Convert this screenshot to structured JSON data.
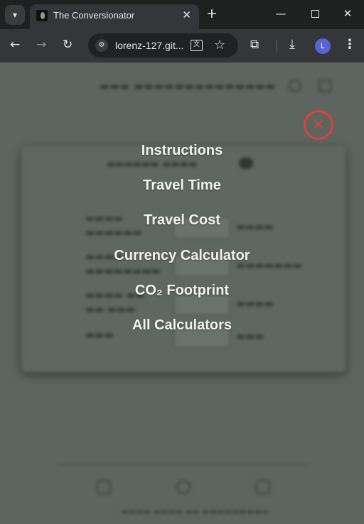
{
  "browser": {
    "tab_title": "The Conversionator",
    "new_tab_symbol": "+",
    "url": "lorenz-127.git...",
    "avatar_initial": "L",
    "icons": [
      "tab-search-icon",
      "favicon-icon",
      "close-icon",
      "plus-icon",
      "minimize-icon",
      "maximize-icon",
      "window-close-icon",
      "back-icon",
      "forward-icon",
      "reload-icon",
      "site-info-icon",
      "translate-icon",
      "star-icon",
      "extensions-icon",
      "download-icon",
      "kebab-menu-icon"
    ]
  },
  "menu": {
    "items": [
      {
        "label": "Instructions"
      },
      {
        "label": "Travel Time"
      },
      {
        "label": "Travel Cost"
      },
      {
        "label": "Currency Calculator"
      },
      {
        "label": "CO₂ Footprint"
      },
      {
        "label": "All Calculators"
      }
    ],
    "close_symbol": "✕",
    "close_color": "#e0413a"
  }
}
